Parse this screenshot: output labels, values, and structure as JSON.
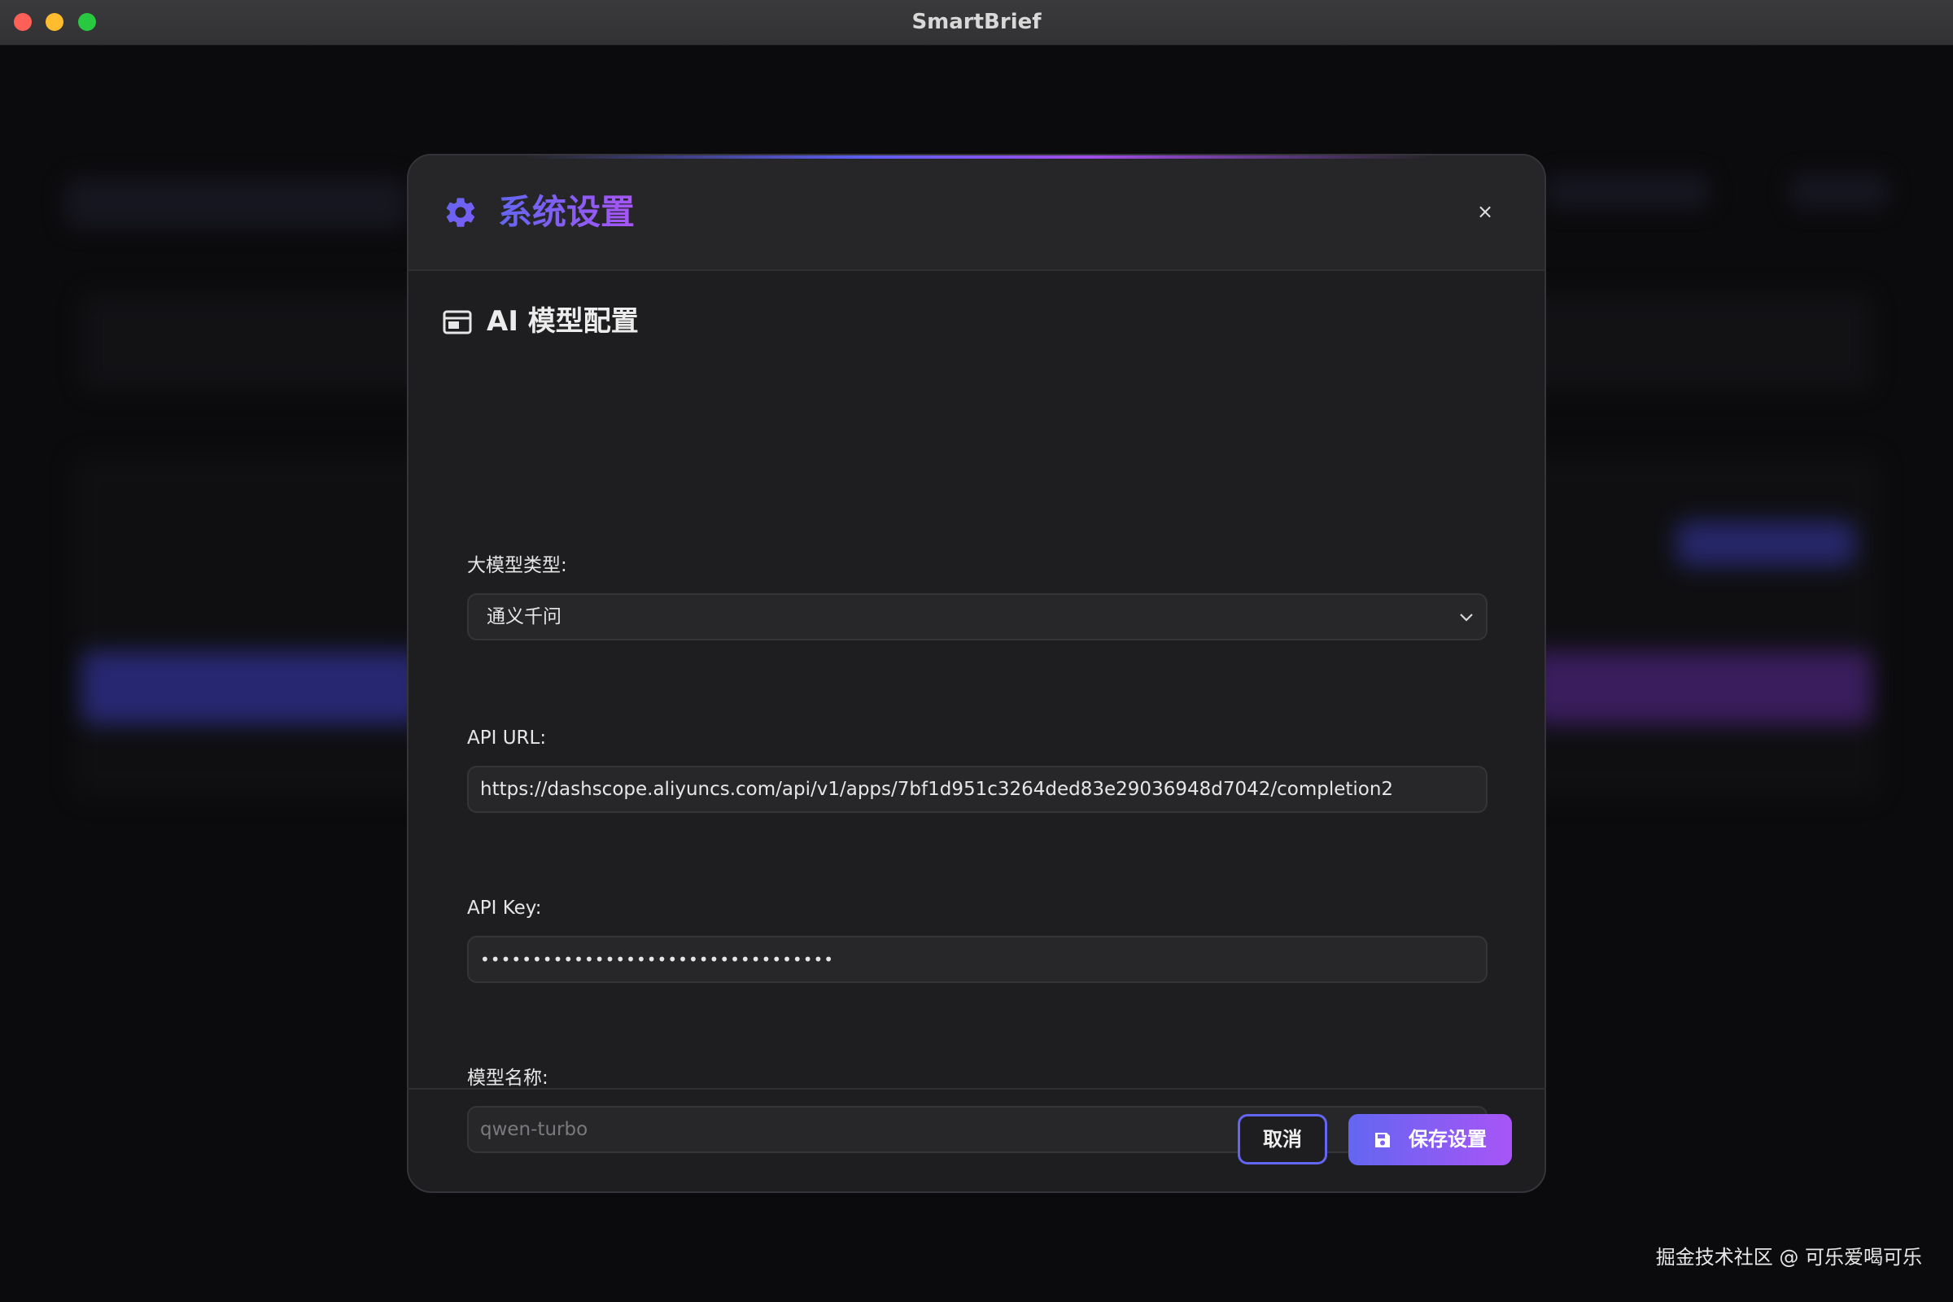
{
  "window": {
    "title": "SmartBrief"
  },
  "modal": {
    "title": "系统设置",
    "close_label": "×",
    "section_title": "AI 模型配置",
    "fields": {
      "model_type": {
        "label": "大模型类型:",
        "value": "通义千问"
      },
      "api_url": {
        "label": "API URL:",
        "value": "https://dashscope.aliyuncs.com/api/v1/apps/7bf1d951c3264ded83e29036948d7042/completion2"
      },
      "api_key": {
        "label": "API Key:",
        "value": "••••••••••••••••••••••••••••••••••"
      },
      "model_name": {
        "label": "模型名称:",
        "placeholder": "qwen-turbo"
      }
    },
    "buttons": {
      "cancel": "取消",
      "save": "保存设置"
    }
  },
  "watermark": "掘金技术社区 @ 可乐爱喝可乐",
  "colors": {
    "accent_start": "#6366f1",
    "accent_end": "#a855f7",
    "modal_bg": "#1e1e20"
  },
  "icons": {
    "header": "gear-icon",
    "section": "window-icon",
    "save": "floppy-disk-icon",
    "select": "chevron-down-icon"
  }
}
